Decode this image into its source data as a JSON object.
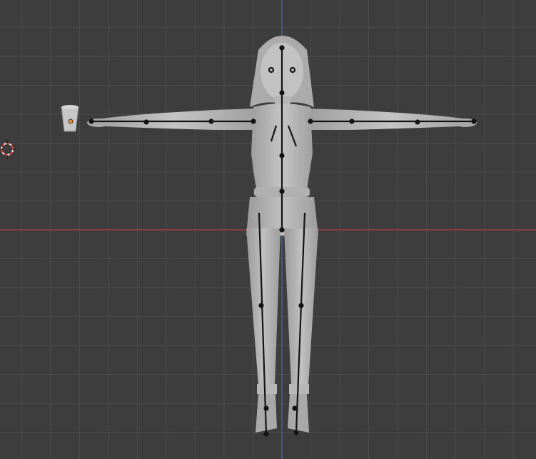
{
  "viewport": {
    "background": "#3d3d3d",
    "grid_color": "#4a4a4a",
    "x_axis_color": "#9e3a44",
    "z_axis_color": "#4a6aa0",
    "model_color": "#b7b7b7",
    "bone_color": "#141414"
  },
  "objects": {
    "mesh": "character-mesh",
    "armature": "armature-bones",
    "camera_icon": "3d-cursor-icon",
    "small_object": "cup-object"
  }
}
